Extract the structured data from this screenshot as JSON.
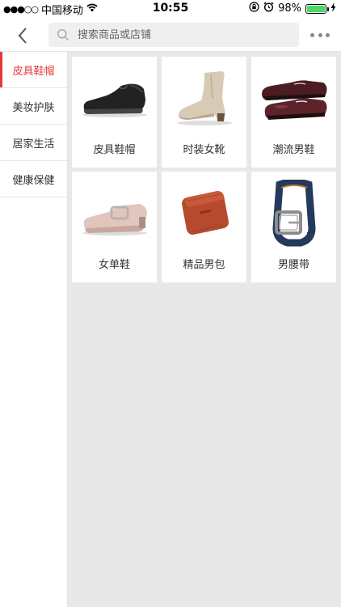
{
  "status_bar": {
    "carrier": "中国移动",
    "time": "10:55",
    "battery": "98%",
    "battery_level": 0.98
  },
  "search": {
    "placeholder": "搜索商品或店铺"
  },
  "sidebar": {
    "items": [
      {
        "label": "皮具鞋帽",
        "active": true
      },
      {
        "label": "美妆护肤",
        "active": false
      },
      {
        "label": "居家生活",
        "active": false
      },
      {
        "label": "健康保健",
        "active": false
      }
    ]
  },
  "categories": [
    {
      "label": "皮具鞋帽",
      "icon": "black-slip-on-shoe-icon"
    },
    {
      "label": "时装女靴",
      "icon": "beige-ankle-boot-icon"
    },
    {
      "label": "潮流男鞋",
      "icon": "burgundy-oxford-shoe-icon"
    },
    {
      "label": "女单鞋",
      "icon": "pink-loafer-icon"
    },
    {
      "label": "精品男包",
      "icon": "brown-wallet-icon"
    },
    {
      "label": "男腰带",
      "icon": "navy-belt-icon"
    }
  ],
  "colors": {
    "accent": "#e4393c",
    "content_bg": "#e8e8e8"
  }
}
